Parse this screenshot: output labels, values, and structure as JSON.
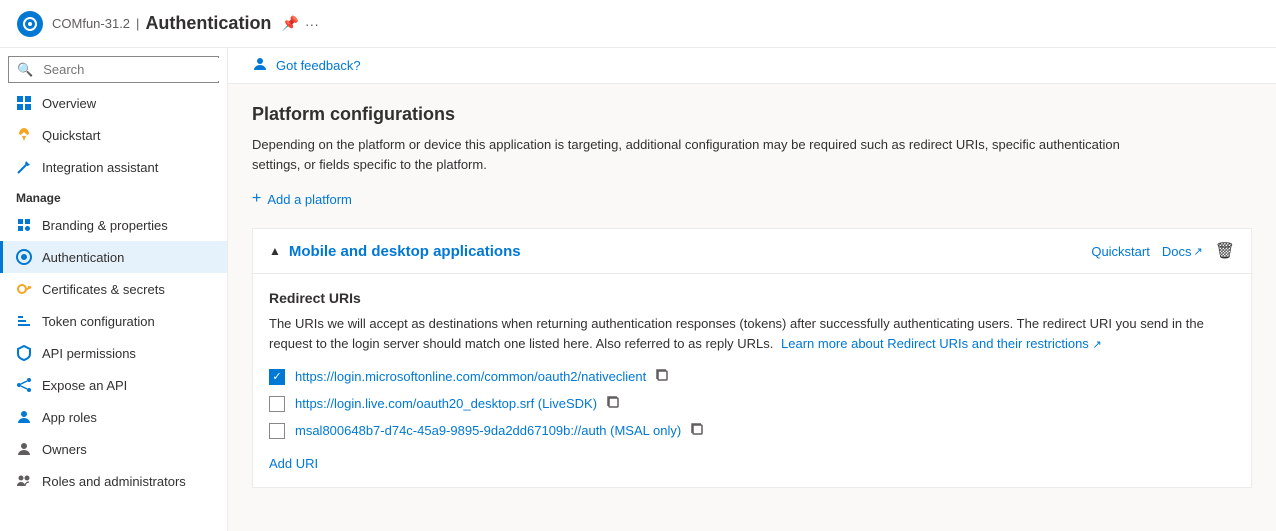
{
  "topbar": {
    "logo_text": "⊙",
    "app_name": "COMfun-31.2",
    "separator": "|",
    "title": "Authentication",
    "pin_icon": "📌",
    "more_icon": "..."
  },
  "sidebar": {
    "search_placeholder": "Search",
    "nav_items": [
      {
        "id": "overview",
        "label": "Overview",
        "icon": "grid"
      },
      {
        "id": "quickstart",
        "label": "Quickstart",
        "icon": "rocket"
      },
      {
        "id": "integration-assistant",
        "label": "Integration assistant",
        "icon": "wand"
      }
    ],
    "manage_label": "Manage",
    "manage_items": [
      {
        "id": "branding",
        "label": "Branding & properties",
        "icon": "palette"
      },
      {
        "id": "authentication",
        "label": "Authentication",
        "icon": "circle",
        "active": true
      },
      {
        "id": "certificates",
        "label": "Certificates & secrets",
        "icon": "key"
      },
      {
        "id": "token-config",
        "label": "Token configuration",
        "icon": "bars"
      },
      {
        "id": "api-permissions",
        "label": "API permissions",
        "icon": "shield"
      },
      {
        "id": "expose-api",
        "label": "Expose an API",
        "icon": "share"
      },
      {
        "id": "app-roles",
        "label": "App roles",
        "icon": "person"
      },
      {
        "id": "owners",
        "label": "Owners",
        "icon": "person"
      },
      {
        "id": "roles-admins",
        "label": "Roles and administrators",
        "icon": "people"
      }
    ]
  },
  "feedback": {
    "icon": "👤",
    "label": "Got feedback?"
  },
  "content": {
    "section_title": "Platform configurations",
    "section_desc": "Depending on the platform or device this application is targeting, additional configuration may be required such as redirect URIs, specific authentication settings, or fields specific to the platform.",
    "add_platform_label": "Add a platform",
    "platform": {
      "title": "Mobile and desktop applications",
      "quickstart_label": "Quickstart",
      "docs_label": "Docs",
      "external_icon": "↗",
      "delete_icon": "🗑",
      "redirect_uris_title": "Redirect URIs",
      "redirect_desc_part1": "The URIs we will accept as destinations when returning authentication responses (tokens) after successfully authenticating users. The redirect URI you send in the request to the login server should match one listed here. Also referred to as reply URLs.",
      "redirect_desc_link": "Learn more about Redirect URIs and their restrictions",
      "uris": [
        {
          "id": "uri1",
          "checked": true,
          "text": "https://login.microsoftonline.com/common/oauth2/nativeclient"
        },
        {
          "id": "uri2",
          "checked": false,
          "text": "https://login.live.com/oauth20_desktop.srf (LiveSDK)"
        },
        {
          "id": "uri3",
          "checked": false,
          "text": "msal800648b7-d74c-45a9-9895-9da2dd67109b://auth (MSAL only)"
        }
      ],
      "add_uri_label": "Add URI"
    }
  }
}
